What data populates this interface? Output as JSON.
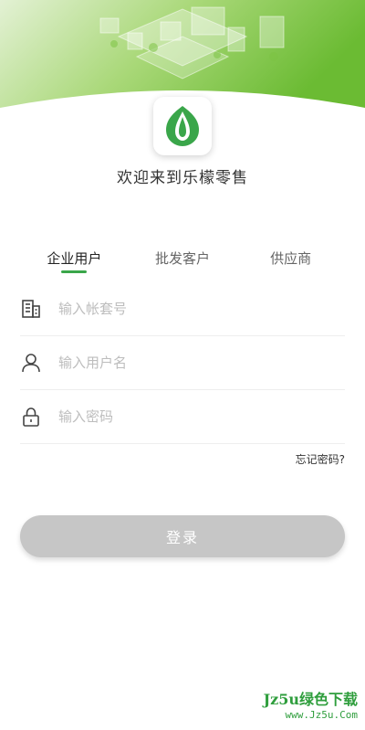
{
  "app": {
    "welcome_text": "欢迎来到乐檬零售"
  },
  "colors": {
    "brand_green": "#3aa64a",
    "hero_light": "#d7ecc3",
    "hero_dark": "#7cc243",
    "button_disabled": "#c6c6c6"
  },
  "tabs": [
    {
      "label": "企业用户",
      "active": true
    },
    {
      "label": "批发客户",
      "active": false
    },
    {
      "label": "供应商",
      "active": false
    }
  ],
  "fields": {
    "account": {
      "placeholder": "输入帐套号",
      "value": "",
      "icon": "building-icon"
    },
    "username": {
      "placeholder": "输入用户名",
      "value": "",
      "icon": "user-icon"
    },
    "password": {
      "placeholder": "输入密码",
      "value": "",
      "icon": "lock-icon"
    }
  },
  "forgot_password": "忘记密码?",
  "login_button": "登录",
  "watermark": {
    "main": "Jz5u绿色下载",
    "sub": "www.Jz5u.Com"
  }
}
